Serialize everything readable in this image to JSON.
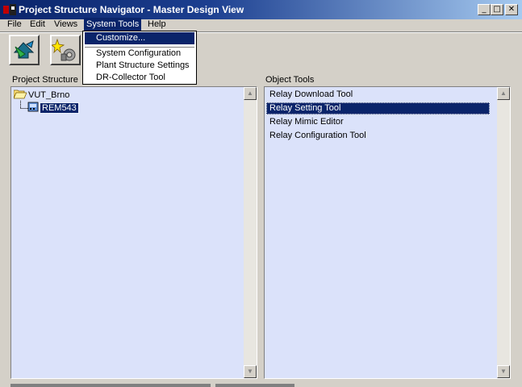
{
  "window": {
    "title": "Project Structure Navigator - Master Design View",
    "icon": "app-logo-icon",
    "controls": [
      {
        "name": "minimize-button",
        "glyph": "_"
      },
      {
        "name": "maximize-button",
        "glyph": "□"
      },
      {
        "name": "close-button",
        "glyph": "✕"
      }
    ]
  },
  "menubar": {
    "file": "File",
    "edit": "Edit",
    "views": "Views",
    "system_tools": "System Tools",
    "help": "Help"
  },
  "toolbar": {
    "buttons": [
      {
        "name": "navigate-icon"
      },
      {
        "name": "tools-wizard-icon"
      }
    ]
  },
  "dropdown": {
    "items": [
      "Customize...",
      "System Configuration",
      "Plant Structure Settings",
      "DR-Collector Tool"
    ],
    "highlighted": "Customize..."
  },
  "project_structure": {
    "label": "Project Structure",
    "tree": [
      {
        "label": "VUT_Brno",
        "icon": "folder-open-icon"
      },
      {
        "label": "REM543",
        "icon": "relay-device-icon",
        "selected": true
      }
    ]
  },
  "object_tools": {
    "label": "Object Tools",
    "items": [
      "Relay Download Tool",
      "Relay Setting Tool",
      "Relay Mimic Editor",
      "Relay Configuration Tool"
    ],
    "selected": "Relay Setting Tool"
  },
  "colors": {
    "titlebar": "#0a246a",
    "face": "#d4d0c8",
    "list_bg": "#dbe2fa",
    "selection": "#0a246a"
  }
}
